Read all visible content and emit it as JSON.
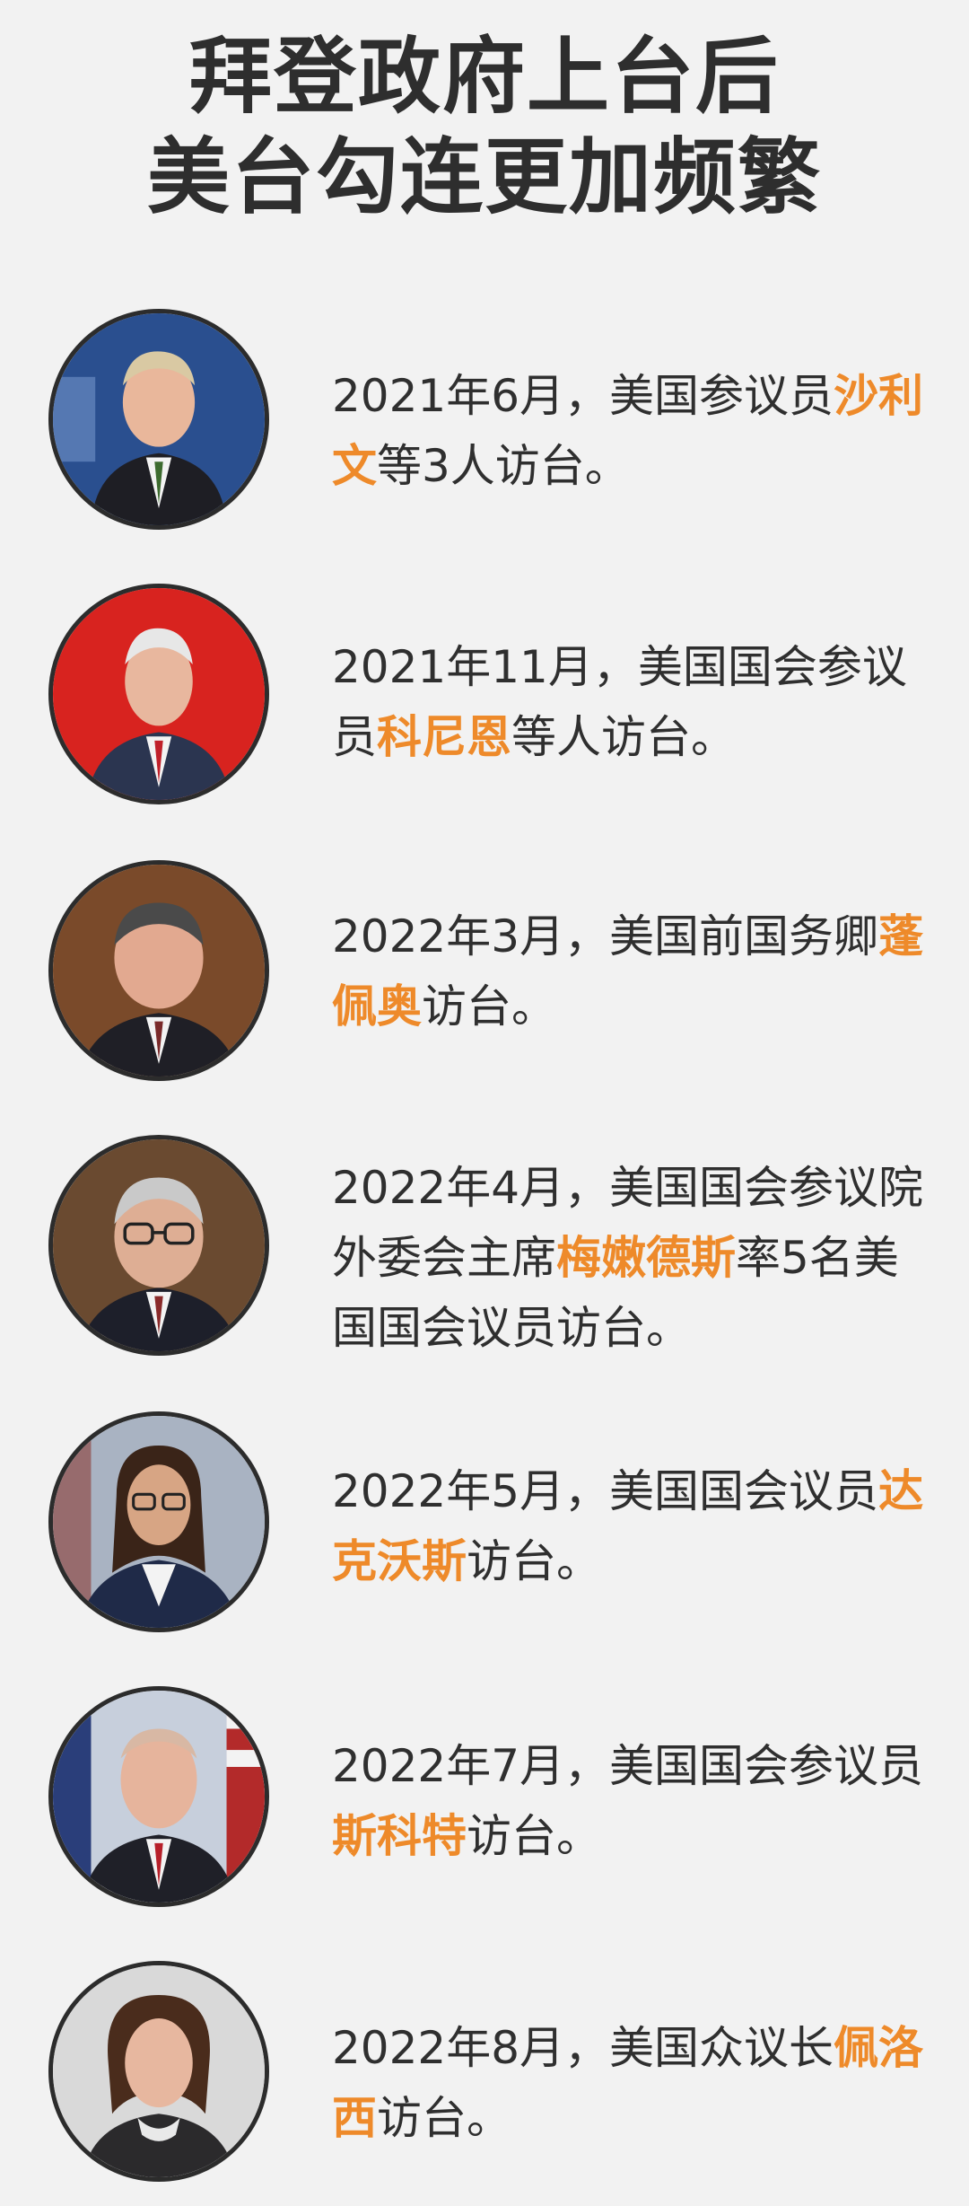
{
  "title": {
    "line1": "拜登政府上台后",
    "line2": "美台勾连更加频繁"
  },
  "items": [
    {
      "pre": "2021年6月，美国参议员",
      "name": "沙利文",
      "post": "等3人访台。",
      "avatar_icon": "portrait-man-blue-backdrop",
      "bg": "#2a4f8f"
    },
    {
      "pre": "2021年11月，美国国会参议员",
      "name": "科尼恩",
      "post": "等人访台。",
      "avatar_icon": "portrait-man-red-backdrop",
      "bg": "#d8231f"
    },
    {
      "pre": "2022年3月，美国前国务卿",
      "name": "蓬佩奥",
      "post": "访台。",
      "avatar_icon": "portrait-man-brown-backdrop",
      "bg": "#7a4a2a"
    },
    {
      "pre": "2022年4月，美国国会参议院外委会主席",
      "name": "梅嫩德斯",
      "post": "率5名美国国会议员访台。",
      "avatar_icon": "portrait-man-glasses",
      "bg": "#6a4a30"
    },
    {
      "pre": "2022年5月，美国国会议员",
      "name": "达克沃斯",
      "post": "访台。",
      "avatar_icon": "portrait-woman-glasses",
      "bg": "#a9b3c2"
    },
    {
      "pre": "2022年7月，美国国会参议员",
      "name": "斯科特",
      "post": "访台。",
      "avatar_icon": "portrait-man-flag-backdrop",
      "bg": "#c7cfdc"
    },
    {
      "pre": "2022年8月，美国众议长",
      "name": "佩洛西",
      "post": "访台。",
      "avatar_icon": "portrait-woman-grey-backdrop",
      "bg": "#d9d9d9"
    }
  ],
  "colors": {
    "background": "#f2f2f2",
    "text": "#2f2f2f",
    "highlight": "#ee8a2a"
  }
}
